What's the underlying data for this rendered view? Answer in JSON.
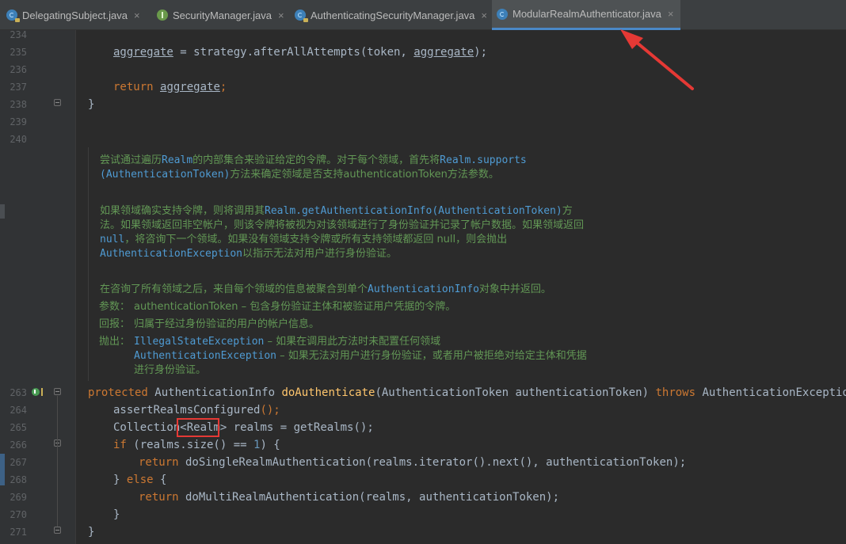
{
  "tabs": [
    {
      "label": "DelegatingSubject.java",
      "icon": "class-icon"
    },
    {
      "label": "SecurityManager.java",
      "icon": "interface-icon"
    },
    {
      "label": "AuthenticatingSecurityManager.java",
      "icon": "class-icon"
    },
    {
      "label": "ModularRealmAuthenticator.java",
      "icon": "class-icon",
      "active": true
    }
  ],
  "close_glyph": "×",
  "line_numbers": {
    "l234": "234",
    "l235": "235",
    "l236": "236",
    "l237": "237",
    "l238": "238",
    "l239": "239",
    "l240": "240",
    "l263": "263",
    "l264": "264",
    "l265": "265",
    "l266": "266",
    "l267": "267",
    "l268": "268",
    "l269": "269",
    "l270": "270",
    "l271": "271"
  },
  "code": {
    "l235": {
      "var": "aggregate",
      "eq": " = strategy.afterAllAttempts(token, ",
      "var2": "aggregate",
      "end": ");"
    },
    "l237": {
      "kw": "return",
      "var": "aggregate",
      "end": ";"
    },
    "l238": "}",
    "l263": {
      "kw1": "protected",
      "type": " AuthenticationInfo ",
      "fn": "doAuthenticate",
      "params": "(AuthenticationToken authenticationToken) ",
      "kw2": "throws",
      "exc": " AuthenticationException {"
    },
    "l264": {
      "fn": "assertRealmsConfigured",
      "end": "();"
    },
    "l265": {
      "pre": "Collection",
      "generic": "<Realm>",
      "post": " realms = getRealms();"
    },
    "l266": {
      "kw": "if",
      "pre": " (realms.size() == ",
      "num": "1",
      "post": ") {"
    },
    "l267": {
      "kw": "return",
      "fn": " doSingleRealmAuthentication",
      "post": "(realms.iterator().next(), authenticationToken);"
    },
    "l268": {
      "pre": "} ",
      "kw": "else",
      "post": " {"
    },
    "l269": {
      "kw": "return",
      "fn": " doMultiRealmAuthentication",
      "post": "(realms, authenticationToken);"
    },
    "l270": "}",
    "l271": "}"
  },
  "doc": {
    "p1a_1": "尝试通过遍历",
    "p1a_m": "Realm",
    "p1a_2": "的内部集合来验证给定的令牌。对于每个领域，首先将",
    "p1a_m2": "Realm.supports",
    "p1b_m": "(AuthenticationToken)",
    "p1b_2": "方法来确定领域是否支持authenticationToken方法参数。",
    "p2a_1": "如果领域确实支持令牌，则将调用其",
    "p2a_m": "Realm.getAuthenticationInfo(AuthenticationToken)",
    "p2a_2": "方",
    "p2b": "法。如果领域返回非空帐户，则该令牌将被视为对该领域进行了身份验证并记录了帐户数据。如果领域返回",
    "p2c_m": "null",
    "p2c_2": "，将咨询下一个领域。如果没有领域支持令牌或所有支持领域都返回 null，则会抛出",
    "p2d_m": "AuthenticationException",
    "p2d_2": "以指示无法对用户进行身份验证。",
    "p3_1": "在咨询了所有领域之后，来自每个领域的信息被聚合到单个",
    "p3_m": "AuthenticationInfo",
    "p3_2": "对象中并返回。",
    "param_label": "参数：",
    "param_text": "authenticationToken – 包含身份验证主体和被验证用户凭据的令牌。",
    "return_label": "回报：",
    "return_text": "归属于经过身份验证的用户的帐户信息。",
    "throws_label": "抛出：",
    "throws1_m": "IllegalStateException",
    "throws1_t": " – 如果在调用此方法时未配置任何领域",
    "throws2_m": "AuthenticationException",
    "throws2_t": " – 如果无法对用户进行身份验证，或者用户被拒绝对给定主体和凭据",
    "throws3": "进行身份验证。"
  },
  "colors": {
    "accent": "#4a88c7",
    "annotation_red": "#e53935"
  }
}
